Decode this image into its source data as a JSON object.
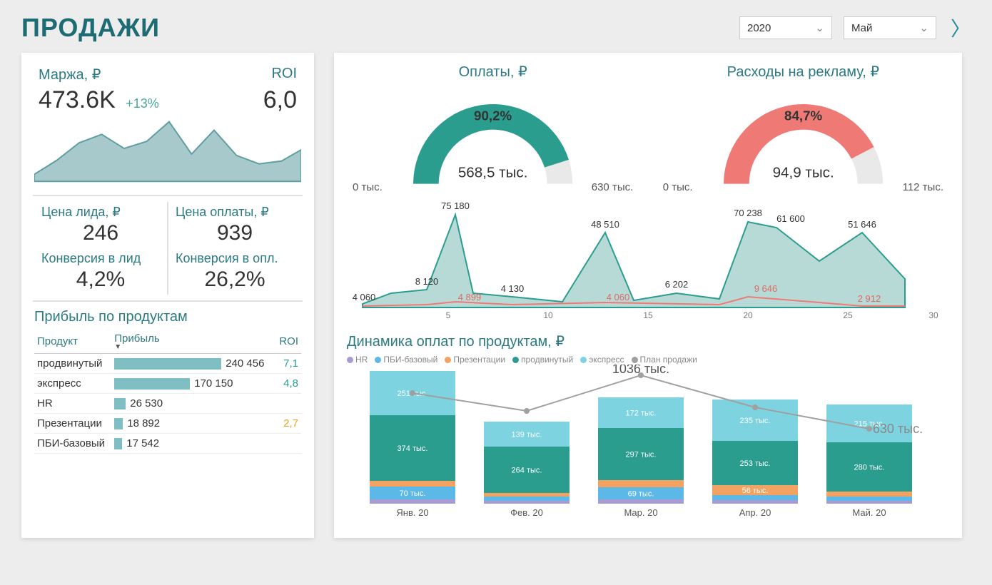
{
  "header": {
    "title": "ПРОДАЖИ",
    "year": "2020",
    "month": "Май"
  },
  "kpi": {
    "margin_label": "Маржа, ₽",
    "margin_value": "473.6K",
    "margin_delta": "+13%",
    "roi_label": "ROI",
    "roi_value": "6,0"
  },
  "mini": {
    "lead_cost_label": "Цена лида, ₽",
    "lead_cost_value": "246",
    "pay_cost_label": "Цена оплаты, ₽",
    "pay_cost_value": "939",
    "conv_lead_label": "Конверсия в лид",
    "conv_lead_value": "4,2%",
    "conv_pay_label": "Конверсия в опл.",
    "conv_pay_value": "26,2%"
  },
  "products": {
    "title": "Прибыль по продуктам",
    "col_product": "Продукт",
    "col_profit": "Прибыль",
    "col_roi": "ROI",
    "rows": [
      {
        "name": "продвинутый",
        "profit": "240 456",
        "roi": "7,1",
        "roi_cls": "roi-pos",
        "w": 150
      },
      {
        "name": "экспресс",
        "profit": "170 150",
        "roi": "4,8",
        "roi_cls": "roi-pos",
        "w": 106
      },
      {
        "name": "HR",
        "profit": "26 530",
        "roi": "",
        "roi_cls": "",
        "w": 16
      },
      {
        "name": "Презентации",
        "profit": "18 892",
        "roi": "2,7",
        "roi_cls": "roi-warn",
        "w": 12
      },
      {
        "name": "ПБИ-базовый",
        "profit": "17 542",
        "roi": "",
        "roi_cls": "",
        "w": 11
      }
    ]
  },
  "gauges": {
    "payments": {
      "title": "Оплаты, ₽",
      "pct": "90,2%",
      "center": "568,5 тыс.",
      "min": "0 тыс.",
      "max": "630 тыс.",
      "frac": 0.902,
      "color": "g-green"
    },
    "ads": {
      "title": "Расходы на рекламу, ₽",
      "pct": "84,7%",
      "center": "94,9 тыс.",
      "min": "0 тыс.",
      "max": "112 тыс.",
      "frac": 0.847,
      "color": "g-red"
    }
  },
  "daily": {
    "labels_top": [
      "8 120",
      "75 180",
      "4 130",
      "48 510",
      "6 202",
      "70 238",
      "61 600",
      "51 646"
    ],
    "start_label": "4 060",
    "labels_red": [
      "4 899",
      "4 060",
      "9 646",
      "2 912"
    ]
  },
  "dynamics": {
    "title": "Динамика оплат по продуктам, ₽",
    "legend": [
      "HR",
      "ПБИ-базовый",
      "Презентации",
      "продвинутый",
      "экспресс",
      "План продажи"
    ],
    "total_label": "1036 тыс.",
    "plan_label": "630 тыс.",
    "months": [
      "Янв. 20",
      "Фев. 20",
      "Мар. 20",
      "Апр. 20",
      "Май. 20"
    ],
    "segment_labels": {
      "jan": {
        "exp": "251 тыс.",
        "adv": "374 тыс.",
        "pbi": "70 тыс."
      },
      "feb": {
        "exp": "139 тыс.",
        "adv": "264 тыс."
      },
      "mar": {
        "exp": "172 тыс.",
        "adv": "297 тыс.",
        "pbi": "69 тыс."
      },
      "apr": {
        "exp": "235 тыс.",
        "adv": "253 тыс.",
        "prez": "56 тыс."
      },
      "may": {
        "exp": "215 тыс.",
        "adv": "280 тыс."
      }
    }
  },
  "chart_data": [
    {
      "type": "area",
      "name": "margin_sparkline",
      "x": [
        1,
        2,
        3,
        4,
        5,
        6,
        7,
        8,
        9,
        10,
        11,
        12,
        13
      ],
      "values": [
        10,
        30,
        55,
        70,
        50,
        60,
        88,
        42,
        76,
        40,
        28,
        33,
        50
      ]
    },
    {
      "type": "gauge",
      "name": "payments",
      "value": 568500,
      "max": 630000,
      "percent": 90.2,
      "unit": "₽"
    },
    {
      "type": "gauge",
      "name": "ad_spend",
      "value": 94900,
      "max": 112000,
      "percent": 84.7,
      "unit": "₽"
    },
    {
      "type": "line",
      "name": "daily_payments_vs_ads",
      "x": [
        1,
        3,
        5,
        6,
        8,
        10,
        13,
        14,
        16,
        18,
        20,
        21,
        23,
        25,
        27
      ],
      "series": [
        {
          "name": "Оплаты",
          "values": [
            4060,
            8120,
            75180,
            9000,
            4130,
            3000,
            48510,
            5000,
            6202,
            5000,
            70238,
            61600,
            40000,
            51646,
            30000
          ]
        },
        {
          "name": "Реклама",
          "values": [
            2000,
            3000,
            4899,
            3500,
            3000,
            2800,
            4060,
            3600,
            3200,
            3800,
            9646,
            6500,
            4000,
            2912,
            2000
          ]
        }
      ],
      "xlabel": "day",
      "x_ticks": [
        5,
        10,
        15,
        20,
        25,
        30
      ]
    },
    {
      "type": "bar",
      "name": "payments_by_product_stacked",
      "categories": [
        "Янв. 20",
        "Фев. 20",
        "Мар. 20",
        "Апр. 20",
        "Май. 20"
      ],
      "series": [
        {
          "name": "HR",
          "values": [
            15,
            10,
            20,
            15,
            10
          ],
          "unit": "тыс."
        },
        {
          "name": "ПБИ-базовый",
          "values": [
            70,
            20,
            69,
            25,
            20
          ],
          "unit": "тыс."
        },
        {
          "name": "Презентации",
          "values": [
            30,
            15,
            40,
            56,
            25
          ],
          "unit": "тыс."
        },
        {
          "name": "продвинутый",
          "values": [
            374,
            264,
            297,
            253,
            280
          ],
          "unit": "тыс."
        },
        {
          "name": "экспресс",
          "values": [
            251,
            139,
            172,
            235,
            215
          ],
          "unit": "тыс."
        }
      ],
      "plan": {
        "name": "План продажи",
        "values": [
          680,
          720,
          1036,
          700,
          630
        ],
        "unit": "тыс."
      },
      "total_highlight": {
        "category": "Мар. 20",
        "value": 1036,
        "unit": "тыс."
      }
    },
    {
      "type": "table",
      "name": "profit_by_product",
      "columns": [
        "Продукт",
        "Прибыль",
        "ROI"
      ],
      "rows": [
        [
          "продвинутый",
          240456,
          7.1
        ],
        [
          "экспресс",
          170150,
          4.8
        ],
        [
          "HR",
          26530,
          null
        ],
        [
          "Презентации",
          18892,
          2.7
        ],
        [
          "ПБИ-базовый",
          17542,
          null
        ]
      ]
    }
  ]
}
